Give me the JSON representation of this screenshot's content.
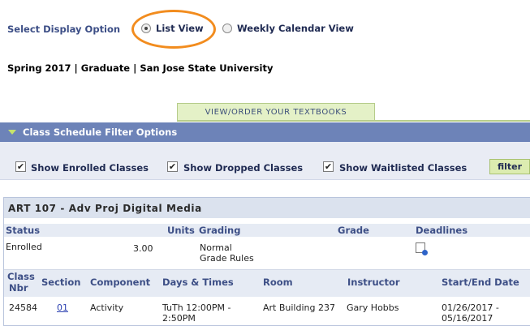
{
  "display_option": {
    "label": "Select Display Option",
    "list_view": "List View",
    "weekly_view": "Weekly Calendar View",
    "selected": "List View"
  },
  "term_info": "Spring 2017 | Graduate | San Jose State University",
  "textbooks_button": "View/Order Your Textbooks",
  "filter": {
    "title": "Class Schedule Filter Options",
    "show_enrolled": "Show Enrolled Classes",
    "show_dropped": "Show Dropped Classes",
    "show_waitlisted": "Show Waitlisted Classes",
    "button": "filter"
  },
  "class": {
    "title": "ART 107 - Adv Proj Digital Media",
    "headers": {
      "status": "Status",
      "units": "Units",
      "grading": "Grading",
      "grade": "Grade",
      "deadlines": "Deadlines"
    },
    "status": "Enrolled",
    "units": "3.00",
    "grading_line1": "Normal",
    "grading_line2": "Grade Rules",
    "section_headers": {
      "class_nbr_1": "Class",
      "class_nbr_2": "Nbr",
      "section": "Section",
      "component": "Component",
      "days_times": "Days & Times",
      "room": "Room",
      "instructor": "Instructor",
      "start_end": "Start/End Date"
    },
    "row": {
      "class_nbr": "24584",
      "section": "01",
      "component": "Activity",
      "days_times_1": "TuTh 12:00PM -",
      "days_times_2": "2:50PM",
      "room": "Art Building 237",
      "instructor": "Gary Hobbs",
      "dates_1": "01/26/2017 -",
      "dates_2": "05/16/2017"
    }
  }
}
